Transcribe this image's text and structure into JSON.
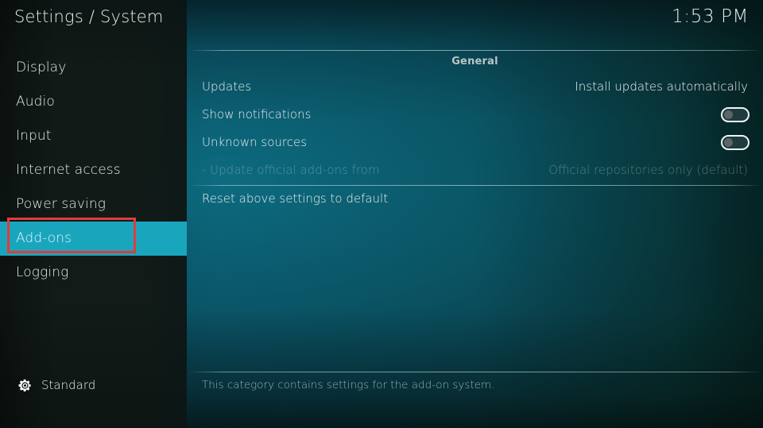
{
  "header": {
    "title": "Settings / System",
    "clock": "1:53 PM"
  },
  "sidebar": {
    "items": [
      {
        "label": "Display",
        "selected": false
      },
      {
        "label": "Audio",
        "selected": false
      },
      {
        "label": "Input",
        "selected": false
      },
      {
        "label": "Internet access",
        "selected": false
      },
      {
        "label": "Power saving",
        "selected": false
      },
      {
        "label": "Add-ons",
        "selected": true
      },
      {
        "label": "Logging",
        "selected": false
      }
    ],
    "level": {
      "icon": "gear-icon",
      "label": "Standard"
    }
  },
  "content": {
    "group_header": "General",
    "rows": [
      {
        "label": "Updates",
        "type": "value",
        "value": "Install updates automatically",
        "disabled": false
      },
      {
        "label": "Show notifications",
        "type": "toggle",
        "value": "off",
        "disabled": false
      },
      {
        "label": "Unknown sources",
        "type": "toggle",
        "value": "off",
        "disabled": false
      },
      {
        "label": "- Update official add-ons from",
        "type": "value",
        "value": "Official repositories only (default)",
        "disabled": true
      },
      {
        "label": "Reset above settings to default",
        "type": "action",
        "value": "",
        "disabled": false
      }
    ],
    "help_text": "This category contains settings for the add-on system."
  },
  "annotation": {
    "type": "highlight-box",
    "color": "#e23b3b",
    "target": "Add-ons"
  },
  "colors": {
    "accent": "#19a6bd",
    "annotation": "#e23b3b",
    "sidebar_bg": "#121b18",
    "panel_bg": "#0a5568"
  }
}
